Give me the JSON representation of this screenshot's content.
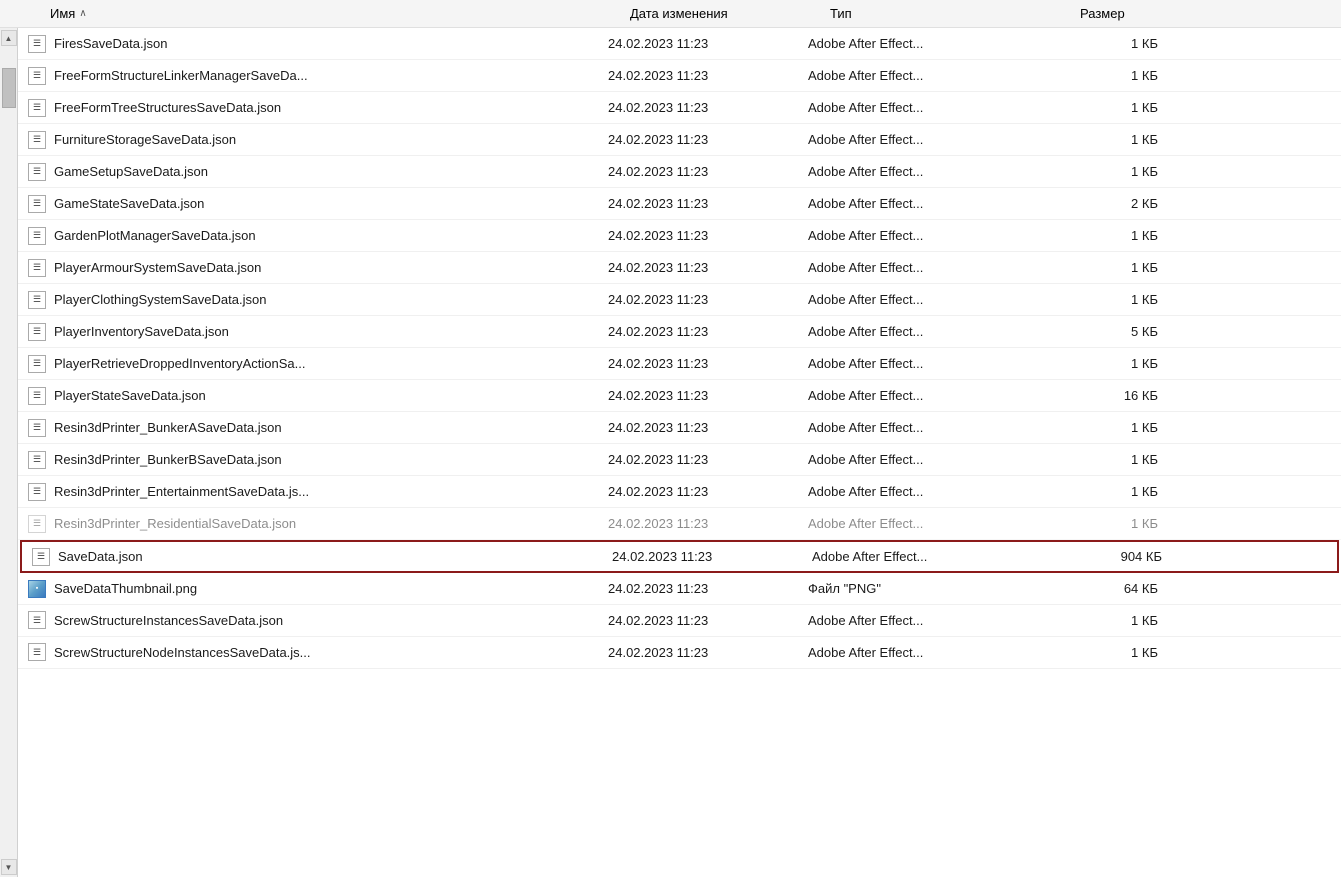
{
  "header": {
    "col_name": "Имя",
    "col_name_sort_arrow": "^",
    "col_date": "Дата изменения",
    "col_type": "Тип",
    "col_size": "Размер"
  },
  "files": [
    {
      "id": 1,
      "name": "FiresSaveData.json",
      "date": "24.02.2023 11:23",
      "type": "Adobe After Effect...",
      "size": "1 КБ",
      "icon": "json",
      "highlighted": false
    },
    {
      "id": 2,
      "name": "FreeFormStructureLinkerManagerSaveDa...",
      "date": "24.02.2023 11:23",
      "type": "Adobe After Effect...",
      "size": "1 КБ",
      "icon": "json",
      "highlighted": false
    },
    {
      "id": 3,
      "name": "FreeFormTreeStructuresSaveData.json",
      "date": "24.02.2023 11:23",
      "type": "Adobe After Effect...",
      "size": "1 КБ",
      "icon": "json",
      "highlighted": false
    },
    {
      "id": 4,
      "name": "FurnitureStorageSaveData.json",
      "date": "24.02.2023 11:23",
      "type": "Adobe After Effect...",
      "size": "1 КБ",
      "icon": "json",
      "highlighted": false
    },
    {
      "id": 5,
      "name": "GameSetupSaveData.json",
      "date": "24.02.2023 11:23",
      "type": "Adobe After Effect...",
      "size": "1 КБ",
      "icon": "json",
      "highlighted": false
    },
    {
      "id": 6,
      "name": "GameStateSaveData.json",
      "date": "24.02.2023 11:23",
      "type": "Adobe After Effect...",
      "size": "2 КБ",
      "icon": "json",
      "highlighted": false
    },
    {
      "id": 7,
      "name": "GardenPlotManagerSaveData.json",
      "date": "24.02.2023 11:23",
      "type": "Adobe After Effect...",
      "size": "1 КБ",
      "icon": "json",
      "highlighted": false
    },
    {
      "id": 8,
      "name": "PlayerArmourSystemSaveData.json",
      "date": "24.02.2023 11:23",
      "type": "Adobe After Effect...",
      "size": "1 КБ",
      "icon": "json",
      "highlighted": false
    },
    {
      "id": 9,
      "name": "PlayerClothingSystemSaveData.json",
      "date": "24.02.2023 11:23",
      "type": "Adobe After Effect...",
      "size": "1 КБ",
      "icon": "json",
      "highlighted": false
    },
    {
      "id": 10,
      "name": "PlayerInventorySaveData.json",
      "date": "24.02.2023 11:23",
      "type": "Adobe After Effect...",
      "size": "5 КБ",
      "icon": "json",
      "highlighted": false
    },
    {
      "id": 11,
      "name": "PlayerRetrieveDroppedInventoryActionSa...",
      "date": "24.02.2023 11:23",
      "type": "Adobe After Effect...",
      "size": "1 КБ",
      "icon": "json",
      "highlighted": false
    },
    {
      "id": 12,
      "name": "PlayerStateSaveData.json",
      "date": "24.02.2023 11:23",
      "type": "Adobe After Effect...",
      "size": "16 КБ",
      "icon": "json",
      "highlighted": false
    },
    {
      "id": 13,
      "name": "Resin3dPrinter_BunkerASaveData.json",
      "date": "24.02.2023 11:23",
      "type": "Adobe After Effect...",
      "size": "1 КБ",
      "icon": "json",
      "highlighted": false
    },
    {
      "id": 14,
      "name": "Resin3dPrinter_BunkerBSaveData.json",
      "date": "24.02.2023 11:23",
      "type": "Adobe After Effect...",
      "size": "1 КБ",
      "icon": "json",
      "highlighted": false
    },
    {
      "id": 15,
      "name": "Resin3dPrinter_EntertainmentSaveData.js...",
      "date": "24.02.2023 11:23",
      "type": "Adobe After Effect...",
      "size": "1 КБ",
      "icon": "json",
      "highlighted": false
    },
    {
      "id": 16,
      "name": "Resin3dPrinter_ResidentialSaveData.json",
      "date": "24.02.2023 11:23",
      "type": "Adobe After Effect...",
      "size": "1 КБ",
      "icon": "json",
      "highlighted": false,
      "partial": true
    },
    {
      "id": 17,
      "name": "SaveData.json",
      "date": "24.02.2023 11:23",
      "type": "Adobe After Effect...",
      "size": "904 КБ",
      "icon": "json",
      "highlighted": true
    },
    {
      "id": 18,
      "name": "SaveDataThumbnail.png",
      "date": "24.02.2023 11:23",
      "type": "Файл \"PNG\"",
      "size": "64 КБ",
      "icon": "png",
      "highlighted": false
    },
    {
      "id": 19,
      "name": "ScrewStructureInstancesSaveData.json",
      "date": "24.02.2023 11:23",
      "type": "Adobe After Effect...",
      "size": "1 КБ",
      "icon": "json",
      "highlighted": false
    },
    {
      "id": 20,
      "name": "ScrewStructureNodeInstancesSaveData.js...",
      "date": "24.02.2023 11:23",
      "type": "Adobe After Effect...",
      "size": "1 КБ",
      "icon": "json",
      "highlighted": false
    }
  ],
  "highlight_color": "#8b1a1a"
}
